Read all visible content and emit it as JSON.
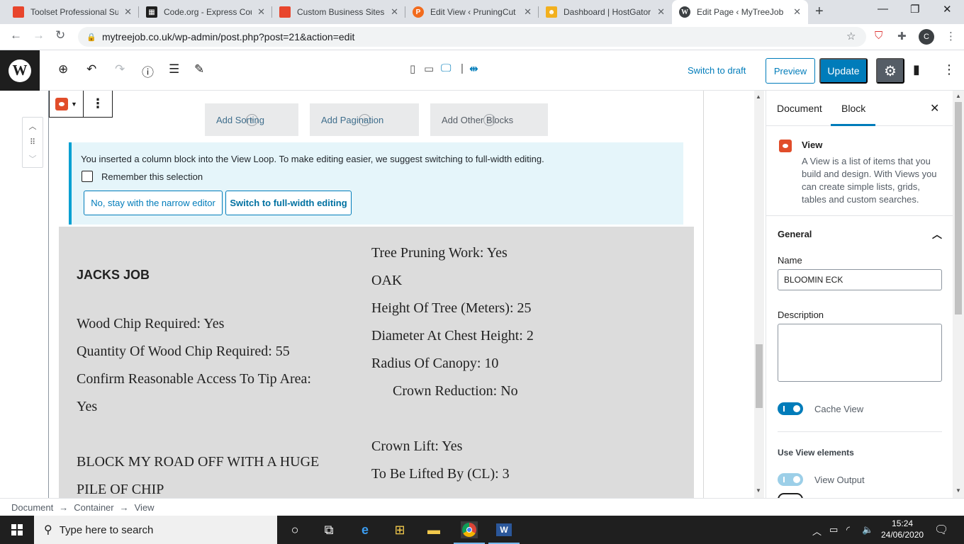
{
  "browser": {
    "tabs": [
      {
        "title": "Toolset Professional Su",
        "color": "#e8452c",
        "glyph": ""
      },
      {
        "title": "Code.org - Express Cou",
        "color": "#1e1e1e",
        "glyph": "▦"
      },
      {
        "title": "Custom Business Sites",
        "color": "#e8452c",
        "glyph": ""
      },
      {
        "title": "Edit View ‹ PruningCut",
        "color": "#f26b1d",
        "glyph": "P"
      },
      {
        "title": "Dashboard | HostGator",
        "color": "#f2b01e",
        "glyph": "☻"
      },
      {
        "title": "Edit Page ‹ MyTreeJob",
        "color": "#3c4043",
        "glyph": "W"
      }
    ],
    "url": "mytreejob.co.uk/wp-admin/post.php?post=21&action=edit",
    "profile_initial": "C"
  },
  "wp_header": {
    "switch_to_draft": "Switch to draft",
    "preview": "Preview",
    "update": "Update"
  },
  "block_toolbar": {
    "more_icon": "⋮"
  },
  "loop_controls": {
    "add_sorting": "Add Sorting",
    "add_pagination": "Add Pagination",
    "add_other": "Add Other Blocks"
  },
  "notice": {
    "message": "You inserted a column block into the View Loop. To make editing easier, we suggest switching to full-width editing.",
    "remember": "Remember this selection",
    "stay_btn": "No, stay with the narrow editor",
    "switch_btn": "Switch to full-width editing"
  },
  "loop_item": {
    "title": "JACKS JOB",
    "left": [
      "Wood Chip Required: Yes",
      "Quantity Of Wood Chip Required: 55",
      "Confirm Reasonable Access To Tip Area:",
      "Yes",
      "BLOCK MY ROAD OFF WITH A HUGE",
      "PILE OF CHIP"
    ],
    "right": [
      "Tree Pruning Work: Yes",
      "OAK",
      "Height Of Tree (Meters): 25",
      "Diameter At Chest Height: 2",
      "Radius Of Canopy: 10",
      "Crown Reduction: No",
      "Crown Lift: Yes",
      "To Be Lifted By (CL): 3"
    ]
  },
  "sidebar": {
    "tab_document": "Document",
    "tab_block": "Block",
    "block_name": "View",
    "block_desc": "A View is a list of items that you build and design. With Views you can create simple lists, grids, tables and custom searches.",
    "general": "General",
    "name_label": "Name",
    "name_value": "BLOOMIN ECK",
    "description_label": "Description",
    "cache_view": "Cache View",
    "use_view_elements": "Use View elements",
    "view_output": "View Output"
  },
  "breadcrumb": [
    "Document",
    "Container",
    "View"
  ],
  "taskbar": {
    "search_placeholder": "Type here to search",
    "time": "15:24",
    "date": "24/06/2020"
  }
}
